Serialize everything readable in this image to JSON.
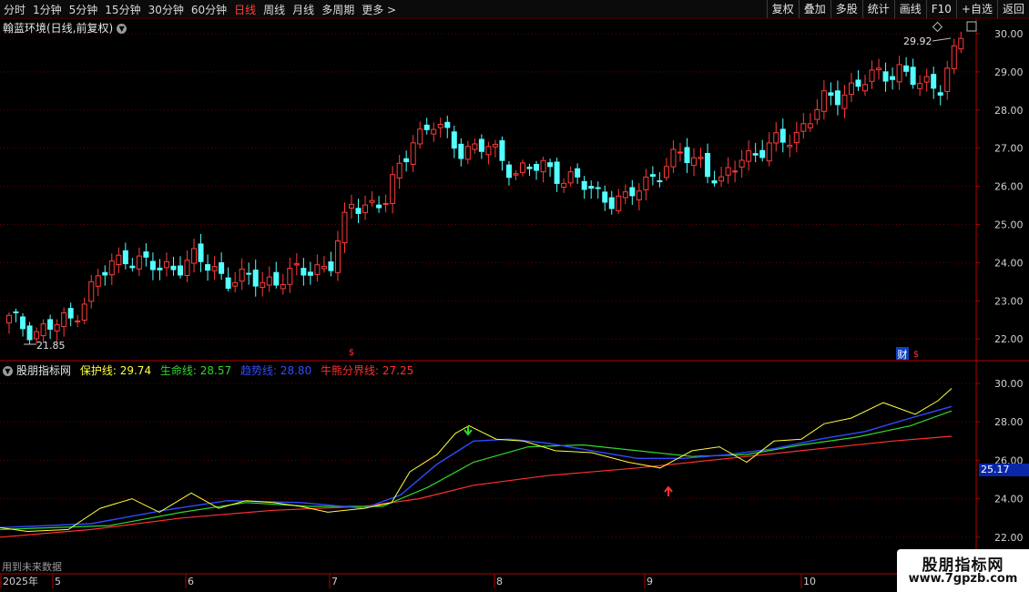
{
  "toolbar": {
    "periods": [
      "分时",
      "1分钟",
      "5分钟",
      "15分钟",
      "30分钟",
      "60分钟",
      "日线",
      "周线",
      "月线",
      "多周期",
      "更多 >"
    ],
    "active_period": "日线",
    "buttons": [
      "复权",
      "叠加",
      "多股",
      "统计",
      "画线",
      "F10",
      "+自选",
      "返回"
    ]
  },
  "main_chart": {
    "title": "翰蓝环境(日线,前复权)",
    "y_ticks": [
      "30.00",
      "29.00",
      "28.00",
      "27.00",
      "26.00",
      "25.00",
      "24.00",
      "23.00",
      "22.00"
    ],
    "high_label": "29.92",
    "low_label": "21.85",
    "finance_marker": "财",
    "dividend_marker": "$"
  },
  "indicator": {
    "name": "股朋指标网",
    "lines": [
      {
        "label": "保护线:",
        "value": "29.74",
        "color": "#ffff3c"
      },
      {
        "label": "生命线:",
        "value": "28.57",
        "color": "#2ed82e"
      },
      {
        "label": "趋势线:",
        "value": "28.80",
        "color": "#2f4bff"
      },
      {
        "label": "牛熊分界线:",
        "value": "27.25",
        "color": "#ff3030"
      }
    ],
    "y_ticks": [
      "30.00",
      "28.00",
      "26.00",
      "24.00",
      "22.00"
    ],
    "current_value": "25.17"
  },
  "time_axis": {
    "labels": [
      "2025年",
      "5",
      "6",
      "7",
      "8",
      "9",
      "10"
    ]
  },
  "future_note": "用到未来数据",
  "watermark": {
    "line1": "股朋指标网",
    "line2": "www.7gpzb.com"
  },
  "colors": {
    "up": "#ff3b3b",
    "down": "#54ffff",
    "grid": "#6b0000",
    "axis": "#b40000"
  }
}
